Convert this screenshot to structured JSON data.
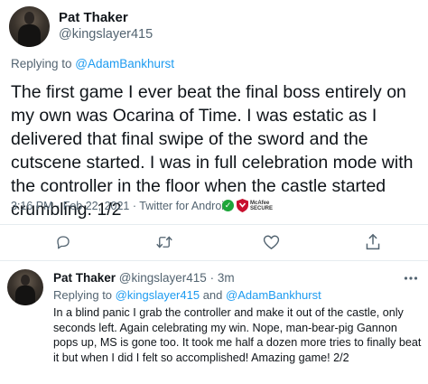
{
  "tweet": {
    "author_name": "Pat Thaker",
    "author_handle": "@kingslayer415",
    "replying_prefix": "Replying to ",
    "replying_handle": "@AdamBankhurst",
    "text": "The first game I ever beat the final boss entirely on my own was Ocarina of Time. I was estatic as I delivered that final swipe of the sword and the cutscene started. I was in full celebration mode with the controller in the floor when the castle started crumbling. 1/2",
    "time": "3:16 PM",
    "date": "Feb 22, 2021",
    "source": "Twitter for Android",
    "sep": "·",
    "mcafee_line1": "McAfee",
    "mcafee_line2": "SECURE"
  },
  "actions": [
    "reply-icon",
    "retweet-icon",
    "like-icon",
    "share-icon"
  ],
  "reply": {
    "author_name": "Pat Thaker",
    "author_handle": "@kingslayer415",
    "sep": "·",
    "age": "3m",
    "replying_prefix": "Replying to ",
    "replying_handle_1": "@kingslayer415",
    "replying_and": " and ",
    "replying_handle_2": "@AdamBankhurst",
    "text": "In a blind panic I grab the controller and make it out of the castle, only seconds left. Again celebrating my win. Nope, man-bear-pig Gannon pops up, MS is gone too. It took me half a dozen more tries to finally beat it but when I did I felt so accomplished! Amazing game! 2/2"
  },
  "colors": {
    "link": "#1d9bf0",
    "secondary_text": "#536471",
    "primary_text": "#0f1419",
    "badge_green": "#1da53a",
    "mcafee_red": "#c8102e"
  }
}
